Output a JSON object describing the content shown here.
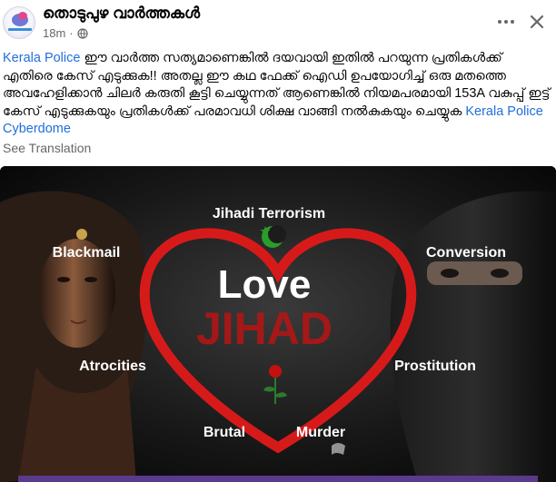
{
  "post": {
    "page_name": "തൊടുപുഴ വാർത്തകൾ",
    "timestamp": "18m",
    "separator": "·",
    "privacy_icon": "globe-icon",
    "more_icon": "ellipsis-icon",
    "close_icon": "close-icon",
    "text": {
      "mention_1": "Kerala Police",
      "body": "  ഈ വാർത്ത സത്യമാണെങ്കിൽ ദയവായി ഇതിൽ പറയുന്ന പ്രതികൾക്ക് എതിരെ കേസ് എടുക്കുക!! അതല്ല ഈ കഥ ഫേക്ക് ഐഡി ഉപയോഗിച്ച് ഒരു മതത്തെ അവഹേളിക്കാൻ ചിലർ കരുതി കൂട്ടി ചെയ്യുന്നത് ആണെങ്കിൽ നിയമപരമായി 153A വകുപ്പ് ഇട്ട് കേസ് എടുക്കുകയും പ്രതികൾക്ക് പരമാവധി ശിക്ഷ വാങ്ങി നൽകുകയും ചെയ്യുക ",
      "mention_2": "Kerala Police Cyberdome"
    },
    "see_translation": "See Translation"
  },
  "image": {
    "top_caption": "Jihadi Terrorism",
    "left_top": "Blackmail",
    "right_top": "Conversion",
    "title_line_1": "Love",
    "title_line_2": "JIHAD",
    "left_bottom": "Atrocities",
    "right_bottom": "Prostitution",
    "bottom_left": "Brutal",
    "bottom_right": "Murder",
    "colors": {
      "heart": "#d61a1a",
      "title_red": "#c11414",
      "crescent": "#2a9d2a",
      "text_white": "#ffffff"
    }
  }
}
